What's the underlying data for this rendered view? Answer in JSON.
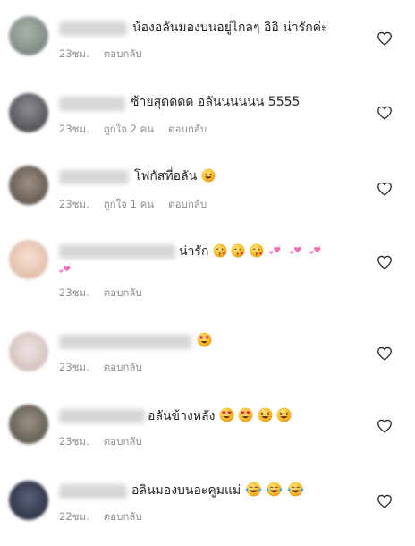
{
  "comments": [
    {
      "text": "น้องอลันมองบนอยู่ไกลๆ อิอิ น่ารักค่ะ",
      "time": "23ชม.",
      "likes": "",
      "reply": "ตอบกลับ",
      "avatar_color": "#7f8a84"
    },
    {
      "text": "ซ้ายสุดดดด อลันนนนนน 5555",
      "time": "23ชม.",
      "likes": "ถูกใจ 2 คน",
      "reply": "ตอบกลับ",
      "avatar_color": "#5b5b5f"
    },
    {
      "text": "โฟกัสที่อลัน",
      "time": "23ชม.",
      "likes": "ถูกใจ 1 คน",
      "reply": "ตอบกลับ",
      "avatar_color": "#6b5f57"
    },
    {
      "text": "น่ารัก",
      "time": "23ชม.",
      "likes": "",
      "reply": "ตอบกลับ",
      "avatar_color": "#e8cbb8"
    },
    {
      "text": "",
      "time": "23ชม.",
      "likes": "",
      "reply": "ตอบกลับ",
      "avatar_color": "#d9c6c6"
    },
    {
      "text": "อลันข้างหลัง",
      "time": "23ชม.",
      "likes": "",
      "reply": "ตอบกลับ",
      "avatar_color": "#716a5e"
    },
    {
      "text": "อลินมองบนอะคูมแม่",
      "time": "22ชม.",
      "likes": "",
      "reply": "ตอบกลับ",
      "avatar_color": "#2e3446"
    }
  ],
  "icons": {
    "like": "heart-outline-icon",
    "emoji_smile": "grinning-face-emoji",
    "emoji_kiss": "kissing-face-emoji",
    "emoji_hearts": "two-hearts-emoji",
    "emoji_love": "heart-eyes-emoji",
    "emoji_laugh": "laughing-face-emoji",
    "emoji_cry_laugh": "tears-of-joy-emoji"
  },
  "colors": {
    "text": "#262626",
    "meta": "#8e8e8e",
    "heart_emoji": "#f06ab0"
  }
}
